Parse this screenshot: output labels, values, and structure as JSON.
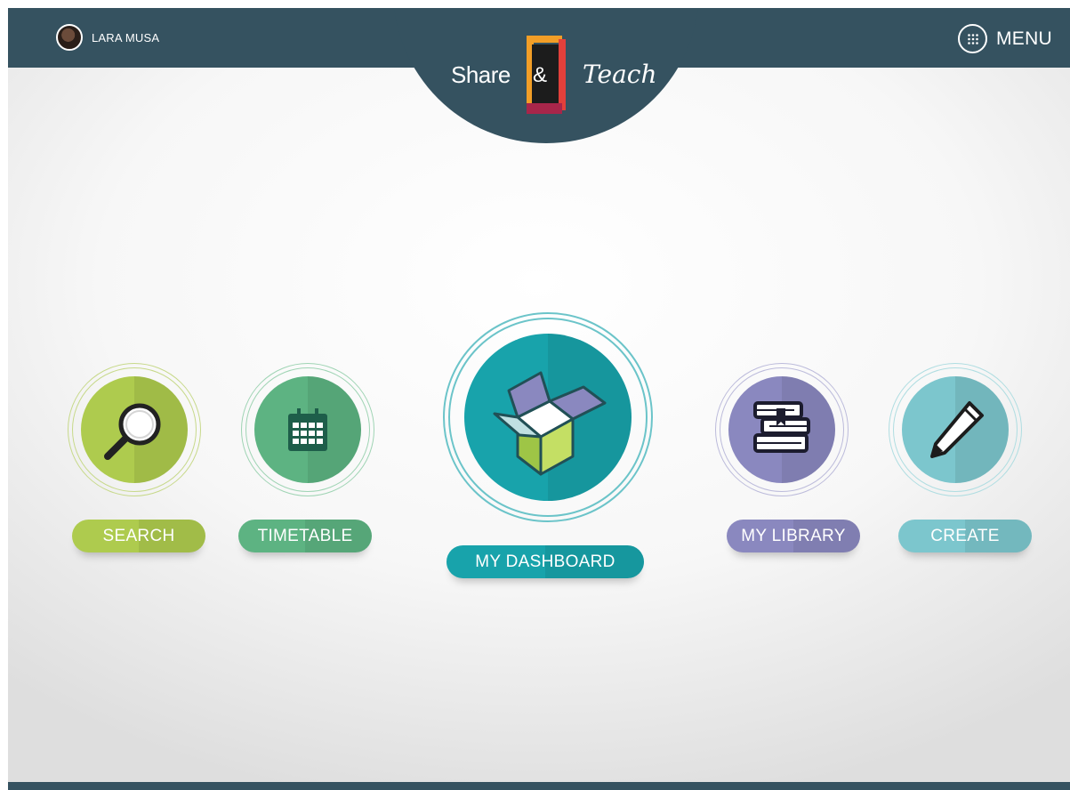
{
  "header": {
    "user_name": "LARA MUSA",
    "menu_label": "MENU",
    "logo": {
      "left_word": "Share",
      "mark": "&",
      "right_word": "Teach"
    }
  },
  "nav": {
    "search": {
      "label": "SEARCH",
      "icon": "search-icon",
      "color": "#aecb4e"
    },
    "timetable": {
      "label": "TIMETABLE",
      "icon": "calendar-icon",
      "color": "#5db382"
    },
    "dashboard": {
      "label": "MY DASHBOARD",
      "icon": "box-icon",
      "color": "#18a3ab"
    },
    "library": {
      "label": "MY LIBRARY",
      "icon": "books-icon",
      "color": "#8a88bf"
    },
    "create": {
      "label": "CREATE",
      "icon": "pencil-icon",
      "color": "#7cc6cd"
    }
  },
  "colors": {
    "bar": "#355260",
    "logo_orange": "#f29e27",
    "logo_red": "#e2403b",
    "logo_dark": "#1c1c1c"
  }
}
